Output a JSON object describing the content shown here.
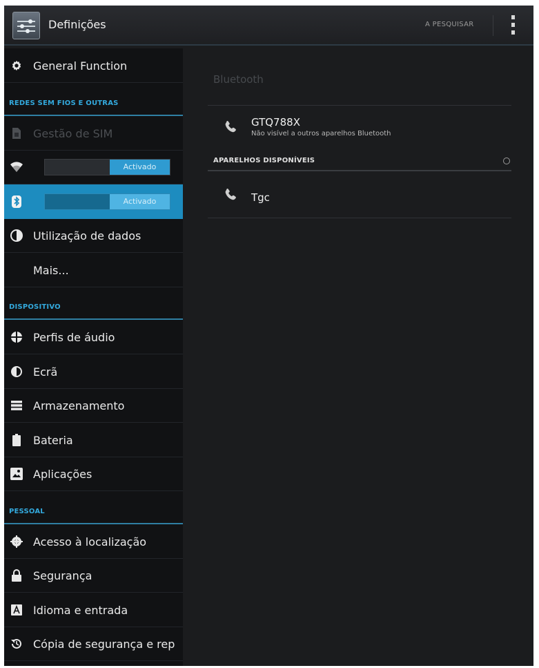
{
  "actionbar": {
    "title": "Definições",
    "search_label": "A PESQUISAR",
    "menu_icon": "overflow-menu-icon"
  },
  "sidebar": {
    "items": [
      {
        "type": "item",
        "icon": "gear-icon",
        "label": "General Function"
      },
      {
        "type": "header",
        "label": "REDES SEM FIOS E OUTRAS"
      },
      {
        "type": "item",
        "icon": "sim-icon",
        "label": "Gestão de SIM",
        "disabled": true
      },
      {
        "type": "toggle",
        "icon": "wifi-icon",
        "toggle_label": "Activado"
      },
      {
        "type": "toggle",
        "icon": "bluetooth-icon",
        "toggle_label": "Activado",
        "selected": true
      },
      {
        "type": "item",
        "icon": "data-usage-icon",
        "label": "Utilização de dados"
      },
      {
        "type": "item",
        "icon": "",
        "label": "Mais..."
      },
      {
        "type": "header",
        "label": "DISPOSITIVO"
      },
      {
        "type": "item",
        "icon": "audio-profiles-icon",
        "label": "Perfis de áudio"
      },
      {
        "type": "item",
        "icon": "display-icon",
        "label": "Ecrã"
      },
      {
        "type": "item",
        "icon": "storage-icon",
        "label": "Armazenamento"
      },
      {
        "type": "item",
        "icon": "battery-icon",
        "label": "Bateria"
      },
      {
        "type": "item",
        "icon": "apps-icon",
        "label": "Aplicações"
      },
      {
        "type": "header",
        "label": "PESSOAL"
      },
      {
        "type": "item",
        "icon": "location-icon",
        "label": "Acesso à localização"
      },
      {
        "type": "item",
        "icon": "lock-icon",
        "label": "Segurança"
      },
      {
        "type": "item",
        "icon": "language-icon",
        "label": "Idioma e entrada"
      },
      {
        "type": "item",
        "icon": "backup-icon",
        "label": "Cópia de segurança e rep"
      }
    ]
  },
  "bluetooth": {
    "title": "Bluetooth",
    "this_device": {
      "name": "GTQ788X",
      "subtitle": "Não visível a outros aparelhos Bluetooth",
      "icon": "phone-icon"
    },
    "available_header": "APARELHOS DISPONÍVEIS",
    "available_devices": [
      {
        "name": "Tgc",
        "icon": "phone-icon"
      }
    ]
  },
  "colors": {
    "accent": "#33a9dd",
    "selected_row": "#1d8cbf",
    "sidebar_bg": "#111214",
    "content_bg": "#1b1c1e"
  }
}
